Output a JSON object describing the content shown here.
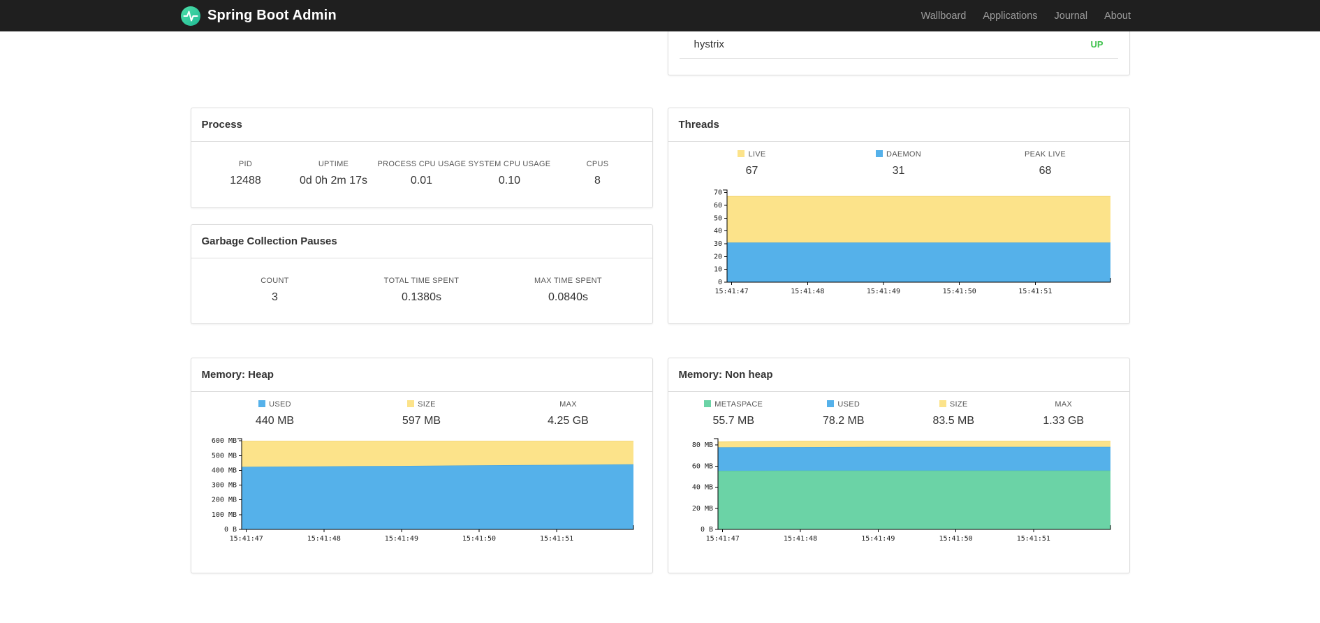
{
  "navbar": {
    "brand": "Spring Boot Admin",
    "links": [
      "Wallboard",
      "Applications",
      "Journal",
      "About"
    ]
  },
  "status_panel": {
    "service": "hystrix",
    "status": "UP"
  },
  "colors": {
    "blue": "#55b1ea",
    "blue_stroke": "#3f9fdd",
    "yellow": "#fce38a",
    "yellow_stroke": "#f3d469",
    "green": "#6bd3a6",
    "green_stroke": "#4fc391",
    "status_up": "#3fc24d"
  },
  "panels": {
    "process": {
      "title": "Process",
      "metrics": [
        {
          "label": "PID",
          "value": "12488"
        },
        {
          "label": "UPTIME",
          "value": "0d 0h 2m 17s"
        },
        {
          "label": "PROCESS CPU USAGE",
          "value": "0.01"
        },
        {
          "label": "SYSTEM CPU USAGE",
          "value": "0.10"
        },
        {
          "label": "CPUS",
          "value": "8"
        }
      ]
    },
    "gc": {
      "title": "Garbage Collection Pauses",
      "metrics": [
        {
          "label": "COUNT",
          "value": "3"
        },
        {
          "label": "TOTAL TIME SPENT",
          "value": "0.1380s"
        },
        {
          "label": "MAX TIME SPENT",
          "value": "0.0840s"
        }
      ]
    },
    "threads": {
      "title": "Threads",
      "metrics": [
        {
          "label": "LIVE",
          "value": "67",
          "swatch": "#fce38a"
        },
        {
          "label": "DAEMON",
          "value": "31",
          "swatch": "#55b1ea"
        },
        {
          "label": "PEAK LIVE",
          "value": "68"
        }
      ]
    },
    "heap": {
      "title": "Memory: Heap",
      "metrics": [
        {
          "label": "USED",
          "value": "440 MB",
          "swatch": "#55b1ea"
        },
        {
          "label": "SIZE",
          "value": "597 MB",
          "swatch": "#fce38a"
        },
        {
          "label": "MAX",
          "value": "4.25 GB"
        }
      ]
    },
    "nonheap": {
      "title": "Memory: Non heap",
      "metrics": [
        {
          "label": "METASPACE",
          "value": "55.7 MB",
          "swatch": "#6bd3a6"
        },
        {
          "label": "USED",
          "value": "78.2 MB",
          "swatch": "#55b1ea"
        },
        {
          "label": "SIZE",
          "value": "83.5 MB",
          "swatch": "#fce38a"
        },
        {
          "label": "MAX",
          "value": "1.33 GB"
        }
      ]
    }
  },
  "chart_data": [
    {
      "id": "threads",
      "type": "area",
      "stacked": true,
      "title": "Threads",
      "x_ticks": [
        "15:41:47",
        "15:41:48",
        "15:41:49",
        "15:41:50",
        "15:41:51"
      ],
      "y_ticks": {
        "values": [
          0,
          10,
          20,
          30,
          40,
          50,
          60,
          70
        ],
        "labels": [
          "0",
          "10",
          "20",
          "30",
          "40",
          "50",
          "60",
          "70"
        ]
      },
      "ylim": [
        0,
        72
      ],
      "legend_position": "top",
      "grid": false,
      "series": [
        {
          "name": "DAEMON",
          "color": "#55b1ea",
          "stroke": "#3f9fdd",
          "values": [
            31,
            31,
            31,
            31,
            31,
            31
          ]
        },
        {
          "name": "LIVE",
          "color": "#fce38a",
          "stroke": "#f3d469",
          "values": [
            67,
            67,
            67,
            67,
            67,
            67
          ]
        }
      ],
      "series_values_are": "cumulative-stack-tops"
    },
    {
      "id": "heap",
      "type": "area",
      "stacked": true,
      "title": "Memory: Heap",
      "x_ticks": [
        "15:41:47",
        "15:41:48",
        "15:41:49",
        "15:41:50",
        "15:41:51"
      ],
      "y_ticks": {
        "values": [
          0,
          100,
          200,
          300,
          400,
          500,
          600
        ],
        "labels": [
          "0 B",
          "100 MB",
          "200 MB",
          "300 MB",
          "400 MB",
          "500 MB",
          "600 MB"
        ]
      },
      "ylim": [
        0,
        615
      ],
      "legend_position": "top",
      "grid": false,
      "series": [
        {
          "name": "USED",
          "color": "#55b1ea",
          "stroke": "#3f9fdd",
          "values": [
            424,
            427,
            430,
            434,
            437,
            441
          ]
        },
        {
          "name": "SIZE",
          "color": "#fce38a",
          "stroke": "#f3d469",
          "values": [
            597,
            597,
            597,
            597,
            597,
            597
          ]
        }
      ],
      "series_values_are": "cumulative-stack-tops"
    },
    {
      "id": "nonheap",
      "type": "area",
      "stacked": true,
      "title": "Memory: Non heap",
      "x_ticks": [
        "15:41:47",
        "15:41:48",
        "15:41:49",
        "15:41:50",
        "15:41:51"
      ],
      "y_ticks": {
        "values": [
          0,
          20,
          40,
          60,
          80
        ],
        "labels": [
          "0 B",
          "20 MB",
          "40 MB",
          "60 MB",
          "80 MB"
        ]
      },
      "ylim": [
        0,
        86
      ],
      "legend_position": "top",
      "grid": false,
      "series": [
        {
          "name": "METASPACE",
          "color": "#6bd3a6",
          "stroke": "#4fc391",
          "values": [
            55.5,
            55.7,
            55.7,
            55.7,
            55.7,
            55.7
          ]
        },
        {
          "name": "USED",
          "color": "#55b1ea",
          "stroke": "#3f9fdd",
          "values": [
            77.8,
            78.0,
            78.2,
            78.2,
            78.2,
            78.2
          ]
        },
        {
          "name": "SIZE",
          "color": "#fce38a",
          "stroke": "#f3d469",
          "values": [
            82.8,
            83.5,
            83.5,
            83.5,
            83.5,
            83.5
          ]
        }
      ],
      "series_values_are": "cumulative-stack-tops"
    }
  ]
}
